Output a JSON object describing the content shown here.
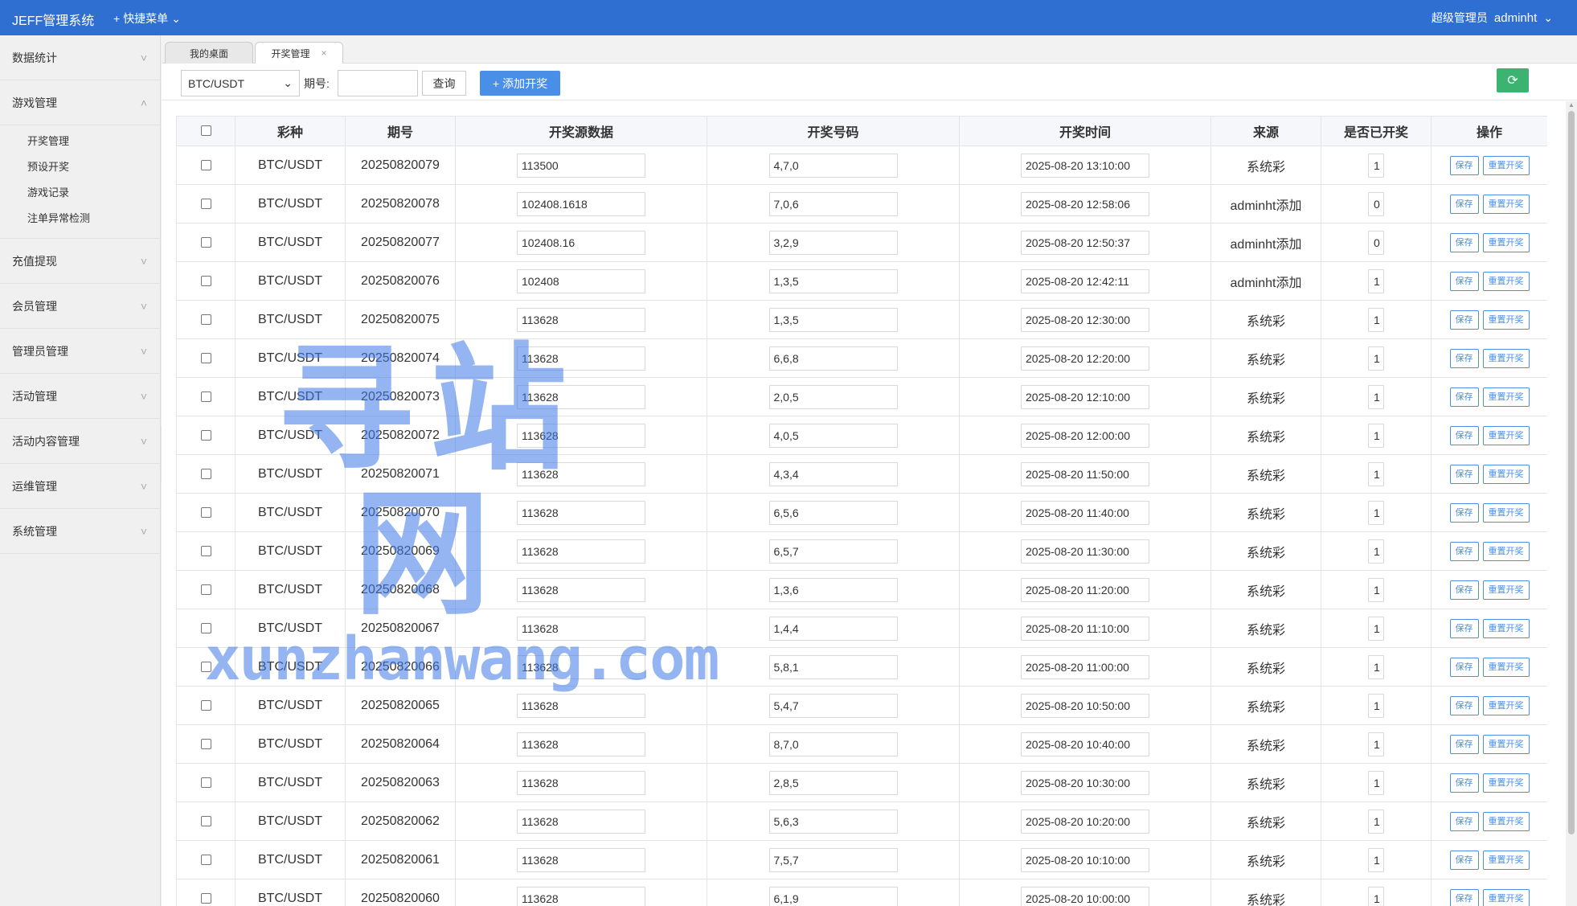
{
  "header": {
    "brand": "JEFF管理系统",
    "quick_menu": "快捷菜单",
    "role": "超级管理员",
    "username": "adminht"
  },
  "sidebar": {
    "menus": [
      {
        "label": "数据统计"
      },
      {
        "label": "游戏管理",
        "expanded": true,
        "children": [
          "开奖管理",
          "预设开奖",
          "游戏记录",
          "注单异常检测"
        ]
      },
      {
        "label": "充值提现"
      },
      {
        "label": "会员管理"
      },
      {
        "label": "管理员管理"
      },
      {
        "label": "活动管理"
      },
      {
        "label": "活动内容管理"
      },
      {
        "label": "运维管理"
      },
      {
        "label": "系统管理"
      }
    ]
  },
  "tabs": [
    {
      "label": "我的桌面"
    },
    {
      "label": "开奖管理",
      "closable": true
    }
  ],
  "toolbar": {
    "select_value": "BTC/USDT",
    "period_label": "期号:",
    "period_value": "",
    "query_label": "查询",
    "add_label": "添加开奖"
  },
  "table": {
    "columns": [
      "彩种",
      "期号",
      "开奖源数据",
      "开奖号码",
      "开奖时间",
      "来源",
      "是否已开奖",
      "操作"
    ],
    "action_save": "保存",
    "action_reset": "重置开奖",
    "rows": [
      [
        "BTC/USDT",
        "20250820079",
        "113500",
        "4,7,0",
        "2025-08-20 13:10:00",
        "系统彩",
        "1"
      ],
      [
        "BTC/USDT",
        "20250820078",
        "102408.1618",
        "7,0,6",
        "2025-08-20 12:58:06",
        "adminht添加",
        "0"
      ],
      [
        "BTC/USDT",
        "20250820077",
        "102408.16",
        "3,2,9",
        "2025-08-20 12:50:37",
        "adminht添加",
        "0"
      ],
      [
        "BTC/USDT",
        "20250820076",
        "102408",
        "1,3,5",
        "2025-08-20 12:42:11",
        "adminht添加",
        "1"
      ],
      [
        "BTC/USDT",
        "20250820075",
        "113628",
        "1,3,5",
        "2025-08-20 12:30:00",
        "系统彩",
        "1"
      ],
      [
        "BTC/USDT",
        "20250820074",
        "113628",
        "6,6,8",
        "2025-08-20 12:20:00",
        "系统彩",
        "1"
      ],
      [
        "BTC/USDT",
        "20250820073",
        "113628",
        "2,0,5",
        "2025-08-20 12:10:00",
        "系统彩",
        "1"
      ],
      [
        "BTC/USDT",
        "20250820072",
        "113628",
        "4,0,5",
        "2025-08-20 12:00:00",
        "系统彩",
        "1"
      ],
      [
        "BTC/USDT",
        "20250820071",
        "113628",
        "4,3,4",
        "2025-08-20 11:50:00",
        "系统彩",
        "1"
      ],
      [
        "BTC/USDT",
        "20250820070",
        "113628",
        "6,5,6",
        "2025-08-20 11:40:00",
        "系统彩",
        "1"
      ],
      [
        "BTC/USDT",
        "20250820069",
        "113628",
        "6,5,7",
        "2025-08-20 11:30:00",
        "系统彩",
        "1"
      ],
      [
        "BTC/USDT",
        "20250820068",
        "113628",
        "1,3,6",
        "2025-08-20 11:20:00",
        "系统彩",
        "1"
      ],
      [
        "BTC/USDT",
        "20250820067",
        "113628",
        "1,4,4",
        "2025-08-20 11:10:00",
        "系统彩",
        "1"
      ],
      [
        "BTC/USDT",
        "20250820066",
        "113628",
        "5,8,1",
        "2025-08-20 11:00:00",
        "系统彩",
        "1"
      ],
      [
        "BTC/USDT",
        "20250820065",
        "113628",
        "5,4,7",
        "2025-08-20 10:50:00",
        "系统彩",
        "1"
      ],
      [
        "BTC/USDT",
        "20250820064",
        "113628",
        "8,7,0",
        "2025-08-20 10:40:00",
        "系统彩",
        "1"
      ],
      [
        "BTC/USDT",
        "20250820063",
        "113628",
        "2,8,5",
        "2025-08-20 10:30:00",
        "系统彩",
        "1"
      ],
      [
        "BTC/USDT",
        "20250820062",
        "113628",
        "5,6,3",
        "2025-08-20 10:20:00",
        "系统彩",
        "1"
      ],
      [
        "BTC/USDT",
        "20250820061",
        "113628",
        "7,5,7",
        "2025-08-20 10:10:00",
        "系统彩",
        "1"
      ],
      [
        "BTC/USDT",
        "20250820060",
        "113628",
        "6,1,9",
        "2025-08-20 10:00:00",
        "系统彩",
        "1"
      ]
    ]
  },
  "watermark": {
    "line1": "寻站网",
    "line2": "xunzhanwang.com"
  },
  "colors": {
    "header": "#2f6fd1",
    "primary": "#4a8fe7",
    "refresh": "#3cb371"
  }
}
